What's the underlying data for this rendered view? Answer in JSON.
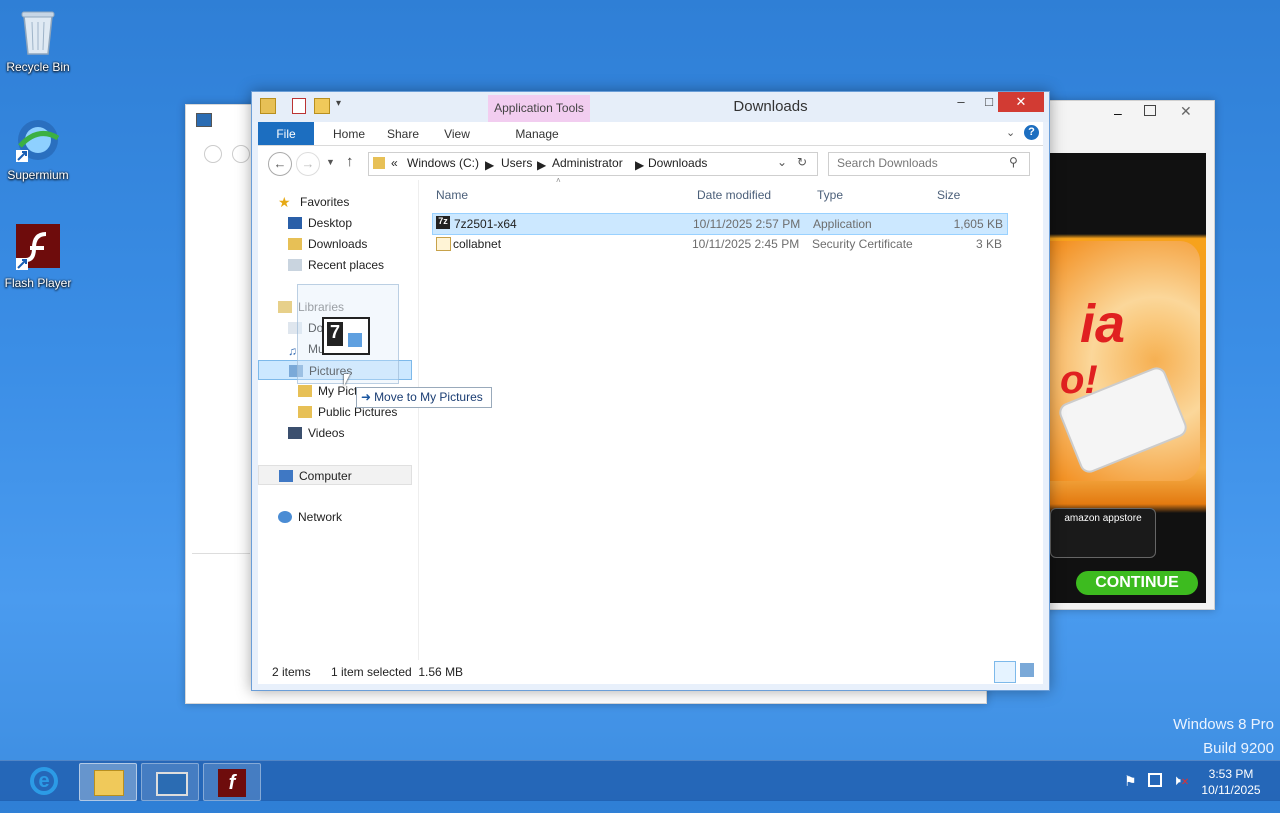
{
  "desktop": {
    "icons": [
      {
        "label": "Recycle Bin",
        "icon": "recycle-bin-icon"
      },
      {
        "label": "Supermium",
        "icon": "supermium-icon"
      },
      {
        "label": "Flash Player",
        "icon": "flash-player-icon"
      }
    ],
    "watermark": {
      "line1": "Windows 8 Pro",
      "line2": "Build 9200"
    }
  },
  "explorer": {
    "title": "Downloads",
    "context_tab": "Application Tools",
    "ribbon_tabs": [
      "File",
      "Home",
      "Share",
      "View",
      "Manage"
    ],
    "breadcrumb": {
      "prefix": "«",
      "parts": [
        "Windows (C:)",
        "Users",
        "Administrator",
        "Downloads"
      ]
    },
    "search_placeholder": "Search Downloads",
    "columns": [
      "Name",
      "Date modified",
      "Type",
      "Size"
    ],
    "files": [
      {
        "name": "7z2501-x64",
        "date": "10/11/2025 2:57 PM",
        "type": "Application",
        "size": "1,605 KB",
        "selected": true
      },
      {
        "name": "collabnet",
        "date": "10/11/2025 2:45 PM",
        "type": "Security Certificate",
        "size": "3 KB",
        "selected": false
      }
    ],
    "nav": {
      "favorites": "Favorites",
      "desktop": "Desktop",
      "downloads": "Downloads",
      "recent": "Recent places",
      "libraries": "Libraries",
      "documents": "Documents",
      "music": "Music",
      "pictures": "Pictures",
      "my_pictures": "My Pictures",
      "public_pictures": "Public Pictures",
      "videos": "Videos",
      "computer": "Computer",
      "network": "Network"
    },
    "status": {
      "items": "2 items",
      "selected": "1 item selected  1.56 MB"
    },
    "drag_tooltip": "Move to My Pictures"
  },
  "taskbar": {
    "time": "3:53 PM",
    "date": "10/11/2025",
    "apps": [
      "internet-explorer-icon",
      "file-explorer-icon",
      "control-panel-icon",
      "flash-player-icon"
    ]
  },
  "colors": {
    "accent": "#1c6ec0",
    "close": "#d23b33",
    "app_tools": "#f2cdf0",
    "selection": "#cce8ff"
  }
}
